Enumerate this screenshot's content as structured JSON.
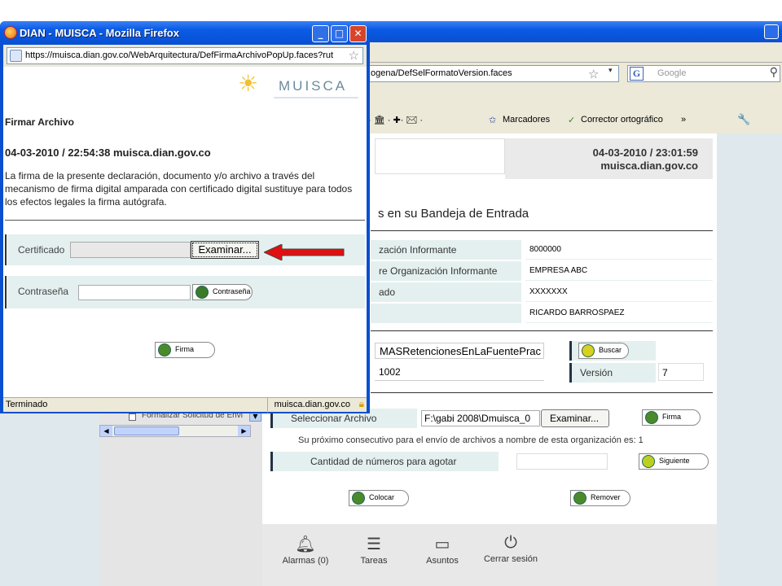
{
  "background_browser": {
    "url": "ogena/DefSelFormatoVersion.faces",
    "search_placeholder": "Google",
    "toolbar_items": [
      "Marcadores",
      "Corrector ortográfico",
      "»"
    ],
    "header_date_line1": "04-03-2010 / 23:01:59",
    "header_date_line2": "muisca.dian.gov.co",
    "section_title": "s en su Bandeja de Entrada",
    "info_rows": [
      {
        "label": "zación Informante",
        "value": "8000000"
      },
      {
        "label": "re Organización Informante",
        "value": "EMPRESA ABC"
      },
      {
        "label": "ado",
        "value": "XXXXXXX"
      },
      {
        "label": "",
        "value": "RICARDO BARROSPAEZ"
      }
    ],
    "formato_name": "MASRetencionesEnLaFuentePrac",
    "formato_number": "1002",
    "buscar_label": "Buscar",
    "version_label": "Versión",
    "version_value": "7",
    "seleccionar_label": "Seleccionar Archivo",
    "file_value": "F:\\gabi 2008\\Dmuisca_0",
    "examinar_label": "Examinar...",
    "firma_label": "Firma",
    "consecutivo_text": "Su próximo consecutivo para el envío de archivos a nombre de esta organización es: 1",
    "cantidad_label": "Cantidad de números para agotar",
    "siguiente_label": "Siguiente",
    "colocar_label": "Colocar",
    "remover_label": "Remover",
    "footer": [
      {
        "icon": "bell-icon",
        "label": "Alarmas (0)"
      },
      {
        "icon": "tasks-icon",
        "label": "Tareas"
      },
      {
        "icon": "folder-icon",
        "label": "Asuntos"
      },
      {
        "icon": "power-icon",
        "label": "Cerrar sesión"
      }
    ],
    "tree_item": "Formalizar Solicitud de Envi"
  },
  "popup": {
    "window_title": "DIAN - MUISCA - Mozilla Firefox",
    "url": "https://muisca.dian.gov.co/WebArquitectura/DefFirmaArchivoPopUp.faces?rut",
    "logo_text": "MUISCA",
    "title": "Firmar Archivo",
    "date_line": "04-03-2010 / 22:54:38 muisca.dian.gov.co",
    "legal_text": "La firma de la presente declaración, documento y/o archivo a través del mecanismo de firma digital amparada con certificado digital sustituye para todos los efectos legales la firma autógrafa.",
    "certificado_label": "Certificado",
    "examinar_label": "Examinar...",
    "contrasena_label": "Contraseña",
    "contrasena_button": "Contraseña",
    "firma_button": "Firma",
    "status": "Terminado",
    "status_domain": "muisca.dian.gov.co"
  },
  "colors": {
    "arrow": "#e01010",
    "titlebar": "#0a5ae3",
    "row_bg": "#e4f0ef"
  }
}
